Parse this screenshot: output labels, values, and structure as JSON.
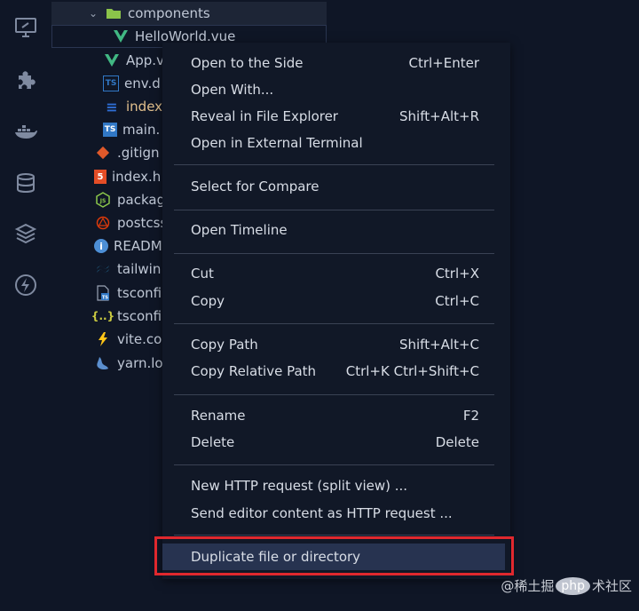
{
  "activity_bar": {
    "icons": [
      "remote-explorer-icon",
      "extensions-icon",
      "docker-icon",
      "database-icon",
      "layers-icon",
      "thunder-client-icon"
    ]
  },
  "explorer": {
    "folder": "components",
    "files": [
      {
        "label": "HelloWorld.vue",
        "icon": "vue-icon"
      },
      {
        "label": "App.v",
        "icon": "vue-icon"
      },
      {
        "label": "env.d",
        "icon": "ts-icon"
      },
      {
        "label": "index",
        "icon": "css-icon"
      },
      {
        "label": "main.",
        "icon": "ts-icon"
      },
      {
        "label": ".gitign",
        "icon": "git-icon"
      },
      {
        "label": "index.h",
        "icon": "html-icon"
      },
      {
        "label": "packag",
        "icon": "nodejs-icon"
      },
      {
        "label": "postcss",
        "icon": "postcss-icon"
      },
      {
        "label": "READM",
        "icon": "info-icon"
      },
      {
        "label": "tailwin",
        "icon": "tailwind-icon"
      },
      {
        "label": "tsconfi",
        "icon": "tsconfig-icon"
      },
      {
        "label": "tsconfi",
        "icon": "json-icon"
      },
      {
        "label": "vite.co",
        "icon": "vite-icon"
      },
      {
        "label": "yarn.lo",
        "icon": "yarn-icon"
      }
    ]
  },
  "menu": {
    "open_to_side": {
      "label": "Open to the Side",
      "shortcut": "Ctrl+Enter"
    },
    "open_with": {
      "label": "Open With..."
    },
    "reveal": {
      "label": "Reveal in File Explorer",
      "shortcut": "Shift+Alt+R"
    },
    "open_terminal": {
      "label": "Open in External Terminal"
    },
    "select_compare": {
      "label": "Select for Compare"
    },
    "open_timeline": {
      "label": "Open Timeline"
    },
    "cut": {
      "label": "Cut",
      "shortcut": "Ctrl+X"
    },
    "copy": {
      "label": "Copy",
      "shortcut": "Ctrl+C"
    },
    "copy_path": {
      "label": "Copy Path",
      "shortcut": "Shift+Alt+C"
    },
    "copy_relative_path": {
      "label": "Copy Relative Path",
      "shortcut": "Ctrl+K Ctrl+Shift+C"
    },
    "rename": {
      "label": "Rename",
      "shortcut": "F2"
    },
    "delete": {
      "label": "Delete",
      "shortcut": "Delete"
    },
    "http_split": {
      "label": "New HTTP request (split view) ..."
    },
    "http_send": {
      "label": "Send editor content as HTTP request ..."
    },
    "duplicate": {
      "label": "Duplicate file or directory"
    }
  },
  "watermark": {
    "prefix": "@稀土掘",
    "logo": "php",
    "suffix": "术社区"
  },
  "colors": {
    "background": "#0f1626",
    "menu_bg": "#111827",
    "highlight": "#273350",
    "annotation_red": "#e0282e",
    "vue_green": "#41b883",
    "ts_blue": "#3178c6",
    "css_blue": "#2e6dd3"
  }
}
